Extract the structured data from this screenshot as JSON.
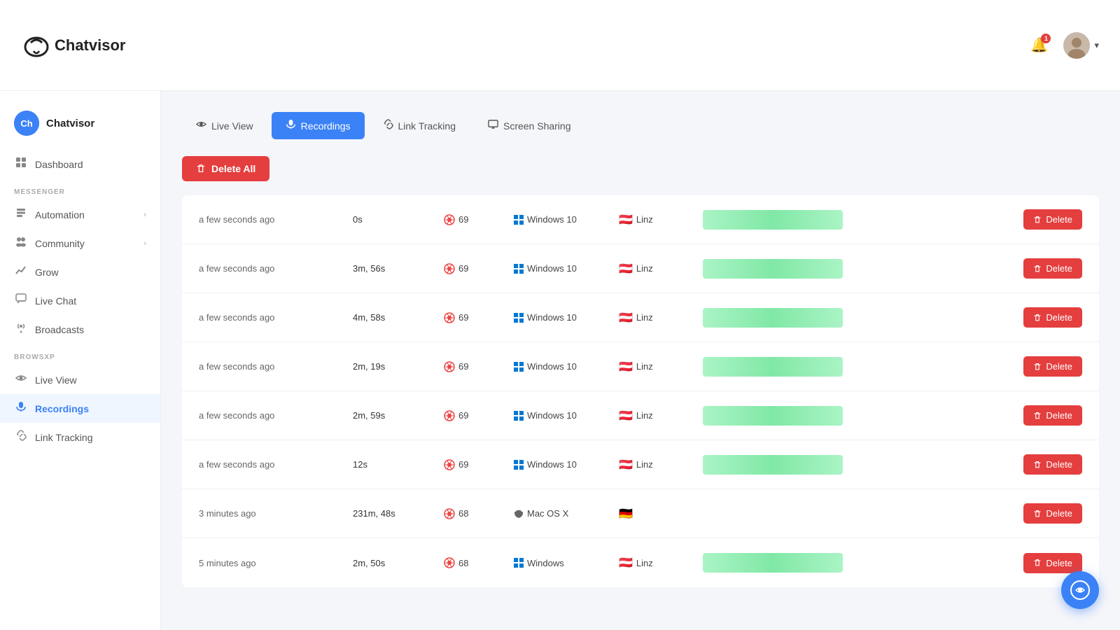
{
  "app": {
    "name": "Chatvisor",
    "logo_letter": "C"
  },
  "header": {
    "notif_count": "1",
    "chevron": "▾"
  },
  "workspace": {
    "name": "Chatvisor",
    "avatar_initials": "Ch"
  },
  "sidebar": {
    "main_items": [
      {
        "id": "dashboard",
        "label": "Dashboard",
        "icon": "📊",
        "active": false
      },
      {
        "id": "automation",
        "label": "Automation",
        "icon": "📄",
        "active": false,
        "has_chevron": true
      },
      {
        "id": "community",
        "label": "Community",
        "icon": "👥",
        "active": false,
        "has_chevron": true
      },
      {
        "id": "grow",
        "label": "Grow",
        "icon": "📈",
        "active": false
      }
    ],
    "messenger_label": "MESSENGER",
    "messenger_items": [
      {
        "id": "live-chat",
        "label": "Live Chat",
        "icon": "💬",
        "active": false
      },
      {
        "id": "broadcasts",
        "label": "Broadcasts",
        "icon": "📡",
        "active": false
      }
    ],
    "browsxp_label": "BROWSXP",
    "browsxp_items": [
      {
        "id": "live-view",
        "label": "Live View",
        "icon": "👁",
        "active": false
      },
      {
        "id": "recordings",
        "label": "Recordings",
        "icon": "🎙",
        "active": true
      },
      {
        "id": "link-tracking",
        "label": "Link Tracking",
        "icon": "🔗",
        "active": false
      }
    ]
  },
  "tabs": [
    {
      "id": "live-view",
      "label": "Live View",
      "icon": "👁",
      "active": false
    },
    {
      "id": "recordings",
      "label": "Recordings",
      "icon": "🎙",
      "active": true
    },
    {
      "id": "link-tracking",
      "label": "Link Tracking",
      "icon": "🔗",
      "active": false
    },
    {
      "id": "screen-sharing",
      "label": "Screen Sharing",
      "icon": "🖥",
      "active": false
    }
  ],
  "buttons": {
    "delete_all": "Delete All",
    "delete": "Delete"
  },
  "recordings": [
    {
      "time_ago": "a few seconds ago",
      "duration": "0s",
      "browser_version": "69",
      "os": "Windows 10",
      "flag": "🇦🇹",
      "city": "Linz",
      "has_thumb": true,
      "thumb_width": 200
    },
    {
      "time_ago": "a few seconds ago",
      "duration": "3m, 56s",
      "browser_version": "69",
      "os": "Windows 10",
      "flag": "🇦🇹",
      "city": "Linz",
      "has_thumb": true,
      "thumb_width": 200
    },
    {
      "time_ago": "a few seconds ago",
      "duration": "4m, 58s",
      "browser_version": "69",
      "os": "Windows 10",
      "flag": "🇦🇹",
      "city": "Linz",
      "has_thumb": true,
      "thumb_width": 200
    },
    {
      "time_ago": "a few seconds ago",
      "duration": "2m, 19s",
      "browser_version": "69",
      "os": "Windows 10",
      "flag": "🇦🇹",
      "city": "Linz",
      "has_thumb": true,
      "thumb_width": 200
    },
    {
      "time_ago": "a few seconds ago",
      "duration": "2m, 59s",
      "browser_version": "69",
      "os": "Windows 10",
      "flag": "🇦🇹",
      "city": "Linz",
      "has_thumb": true,
      "thumb_width": 200
    },
    {
      "time_ago": "a few seconds ago",
      "duration": "12s",
      "browser_version": "69",
      "os": "Windows 10",
      "flag": "🇦🇹",
      "city": "Linz",
      "has_thumb": true,
      "thumb_width": 200
    },
    {
      "time_ago": "3 minutes ago",
      "duration": "231m, 48s",
      "browser_version": "68",
      "os": "Mac OS X",
      "flag": "🇩🇪",
      "city": "",
      "has_thumb": false,
      "thumb_width": 0
    },
    {
      "time_ago": "5 minutes ago",
      "duration": "2m, 50s",
      "browser_version": "68",
      "os": "Windows",
      "flag": "🇦🇹",
      "city": "Linz",
      "has_thumb": true,
      "thumb_width": 200
    }
  ]
}
